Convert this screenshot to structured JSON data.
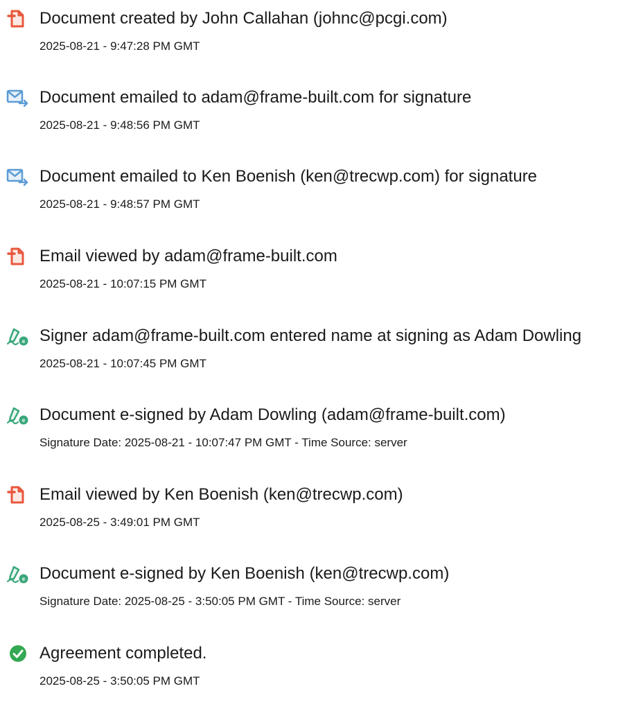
{
  "colors": {
    "doc_icon": "#e8573c",
    "email_icon": "#5b9bd5",
    "sign_icon": "#3aa77a",
    "complete_icon": "#34a853",
    "text": "#1a1a1a"
  },
  "events": [
    {
      "icon": "document-icon",
      "title": "Document created by John Callahan (johnc@pcgi.com)",
      "subtitle": "2025-08-21 - 9:47:28 PM GMT"
    },
    {
      "icon": "email-send-icon",
      "title": "Document emailed to adam@frame-built.com for signature",
      "subtitle": "2025-08-21 - 9:48:56 PM GMT"
    },
    {
      "icon": "email-send-icon",
      "title": "Document emailed to Ken Boenish (ken@trecwp.com) for signature",
      "subtitle": "2025-08-21 - 9:48:57 PM GMT"
    },
    {
      "icon": "document-icon",
      "title": "Email viewed by adam@frame-built.com",
      "subtitle": "2025-08-21 - 10:07:15 PM GMT"
    },
    {
      "icon": "pen-sign-icon",
      "title": "Signer adam@frame-built.com entered name at signing as Adam Dowling",
      "subtitle": "2025-08-21 - 10:07:45 PM GMT"
    },
    {
      "icon": "pen-sign-icon",
      "title": "Document e-signed by Adam Dowling (adam@frame-built.com)",
      "subtitle": "Signature Date: 2025-08-21 - 10:07:47 PM GMT - Time Source: server"
    },
    {
      "icon": "document-icon",
      "title": "Email viewed by Ken Boenish (ken@trecwp.com)",
      "subtitle": "2025-08-25 - 3:49:01 PM GMT"
    },
    {
      "icon": "pen-sign-icon",
      "title": "Document e-signed by Ken Boenish (ken@trecwp.com)",
      "subtitle": "Signature Date: 2025-08-25 - 3:50:05 PM GMT - Time Source: server"
    },
    {
      "icon": "check-circle-icon",
      "title": "Agreement completed.",
      "subtitle": "2025-08-25 - 3:50:05 PM GMT"
    }
  ]
}
